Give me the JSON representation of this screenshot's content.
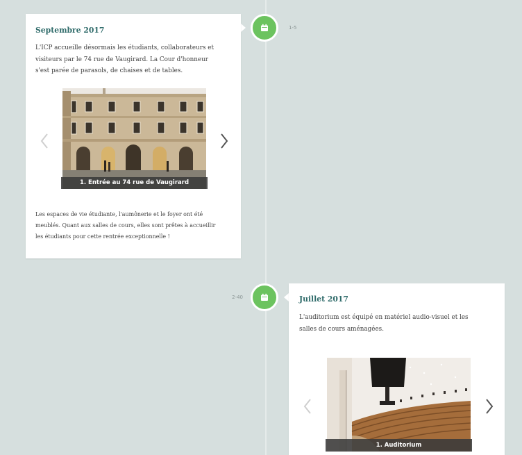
{
  "colors": {
    "background": "#d6dfde",
    "timeline_line": "#e5ebea",
    "marker": "#6cc35f",
    "title": "#2f6b6a",
    "caption_bar": "#3a3a3a"
  },
  "icons": {
    "marker": "calendar-icon",
    "previous": "chevron-left-icon",
    "next": "chevron-right-icon"
  },
  "timeline": {
    "events": [
      {
        "marker_label": "1-5",
        "title": "Septembre 2017",
        "intro_lines": [
          "L'ICP accueille désormais les étudiants, collaborateurs et",
          "visiteurs par le 74 rue de Vaugirard. La Cour d'honneur",
          "s'est parée de parasols, de chaises et de tables."
        ],
        "slider": {
          "caption": "1. Entrée au 74 rue de Vaugirard"
        },
        "outro_lines": [
          "Les espaces de vie étudiante, l'aumônerie et le foyer ont été",
          "meublés. Quant aux salles de cours, elles sont prêtes à accueillir",
          "les étudiants pour cette rentrée exceptionnelle !"
        ]
      },
      {
        "marker_label": "2-40",
        "title": "Juillet 2017",
        "intro_lines": [
          "L'auditorium est équipé en matériel audio-visuel et les",
          "salles de cours aménagées."
        ],
        "slider": {
          "caption": "1. Auditorium"
        }
      }
    ]
  }
}
